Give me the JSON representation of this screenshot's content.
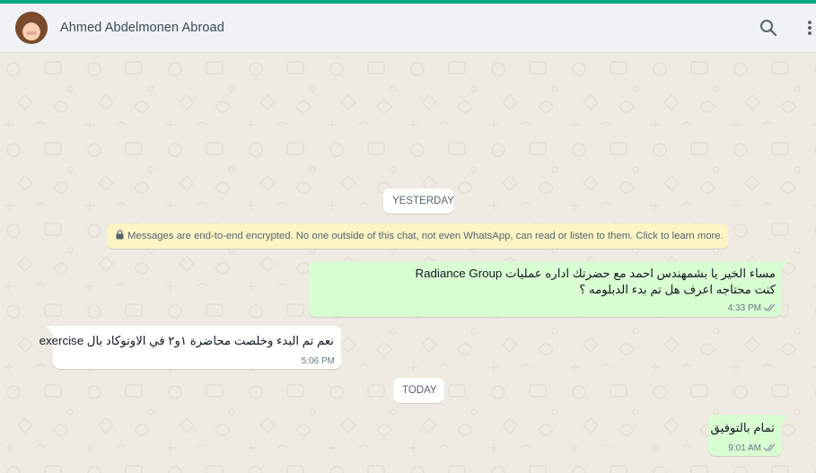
{
  "header": {
    "contact_name": "Ahmed Abdelmonen Abroad",
    "avatar_icon": "contact-avatar",
    "search_icon": "search-icon",
    "menu_icon": "kebab-menu-icon"
  },
  "colors": {
    "accent": "#00a884",
    "outgoing_bubble": "#d9fdd3",
    "incoming_bubble": "#ffffff",
    "notice_bg": "#fdf4c5",
    "chat_bg": "#efeae2",
    "read_ticks": "#8696a0"
  },
  "chat": {
    "date_yesterday": "YESTERDAY",
    "encryption_notice": "Messages are end-to-end encrypted. No one outside of this chat, not even WhatsApp, can read or listen to them. Click to learn more.",
    "date_today": "TODAY",
    "messages": [
      {
        "direction": "outgoing",
        "lines": [
          "مساء الخير يا بشمهندس احمد مع حضرتك اداره عمليات Radiance Group",
          "كنت محتاجه اعرف هل تم بدء الدبلومه ؟"
        ],
        "time": "4:33 PM",
        "status": "read"
      },
      {
        "direction": "incoming",
        "lines": [
          "نعم تم البدء وخلصت محاضرة ١و٢ في الاوتوكاد بال exercise"
        ],
        "time": "5:06 PM"
      },
      {
        "direction": "outgoing",
        "lines": [
          "تمام بالتوفيق"
        ],
        "time": "9:01 AM",
        "status": "read"
      }
    ]
  }
}
